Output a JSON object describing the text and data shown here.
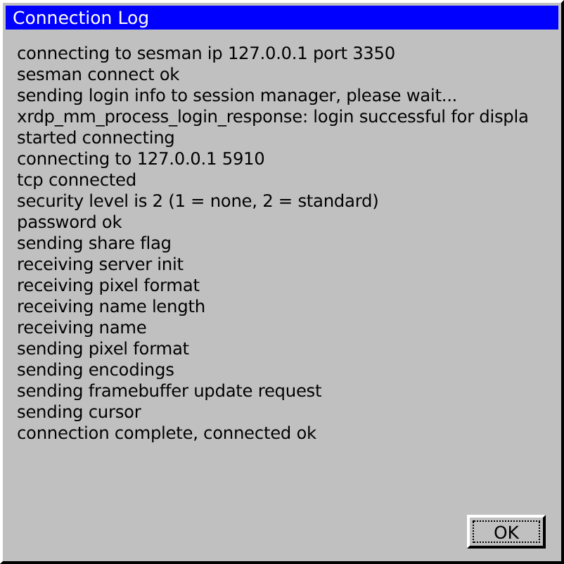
{
  "window": {
    "title": "Connection Log"
  },
  "log_lines": [
    "connecting to sesman ip 127.0.0.1 port 3350",
    "sesman connect ok",
    "sending login info to session manager, please wait...",
    "xrdp_mm_process_login_response: login successful for displa",
    "started connecting",
    "connecting to 127.0.0.1 5910",
    "tcp connected",
    "security level is 2 (1 = none, 2 = standard)",
    "password ok",
    "sending share flag",
    "receiving server init",
    "receiving pixel format",
    "receiving name length",
    "receiving name",
    "sending pixel format",
    "sending encodings",
    "sending framebuffer update request",
    "sending cursor",
    "connection complete, connected ok"
  ],
  "buttons": [
    {
      "label": "OK",
      "focused": true
    }
  ]
}
